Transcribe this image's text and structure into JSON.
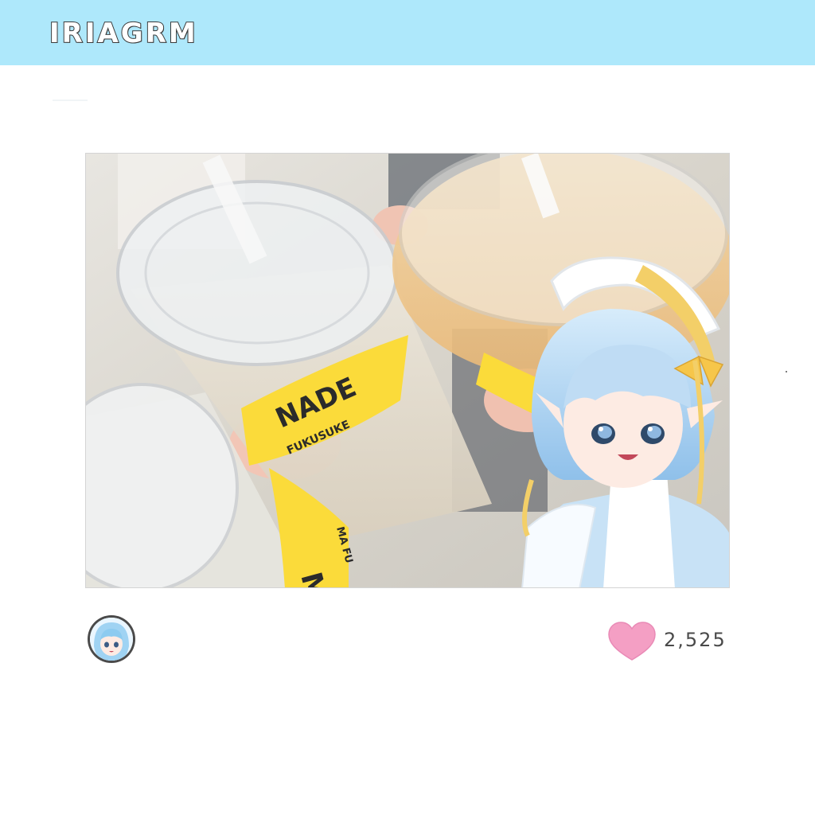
{
  "header": {
    "app_title": "IRIAGRM",
    "background_color": "#aee8fb"
  },
  "post": {
    "photo": {
      "cup_labels": [
        {
          "line1": "NADE",
          "line2": "FUKUSUKE"
        },
        {
          "line1": "MO",
          "line2": "MA FU"
        }
      ]
    },
    "like_count": "2,525",
    "heart_color": "#f49fc4",
    "icons": [
      "heart-icon",
      "user-avatar"
    ]
  }
}
